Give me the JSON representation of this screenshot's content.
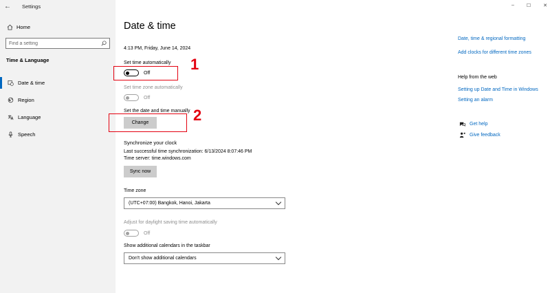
{
  "window": {
    "title": "Settings",
    "back_glyph": "←",
    "controls": [
      "–",
      "☐",
      "✕"
    ]
  },
  "sidebar": {
    "home_label": "Home",
    "search_placeholder": "Find a setting",
    "section_title": "Time & Language",
    "items": [
      {
        "label": "Date & time",
        "icon": "calendar-clock-icon",
        "active": true
      },
      {
        "label": "Region",
        "icon": "globe-icon",
        "active": false
      },
      {
        "label": "Language",
        "icon": "language-icon",
        "active": false
      },
      {
        "label": "Speech",
        "icon": "microphone-icon",
        "active": false
      }
    ]
  },
  "main": {
    "title": "Date & time",
    "current_datetime": "4:13 PM, Friday, June 14, 2024",
    "set_time_auto": {
      "label": "Set time automatically",
      "state": "Off"
    },
    "set_tz_auto": {
      "label": "Set time zone automatically",
      "state": "Off"
    },
    "set_manual": {
      "label": "Set the date and time manually",
      "button": "Change"
    },
    "sync": {
      "heading": "Synchronize your clock",
      "last_sync": "Last successful time synchronization: 6/13/2024 8:07:46 PM",
      "server": "Time server: time.windows.com",
      "button": "Sync now"
    },
    "timezone": {
      "label": "Time zone",
      "value": "(UTC+07:00) Bangkok, Hanoi, Jakarta"
    },
    "dst": {
      "label": "Adjust for daylight saving time automatically",
      "state": "Off"
    },
    "calendars": {
      "label": "Show additional calendars in the taskbar",
      "value": "Don't show additional calendars"
    }
  },
  "right": {
    "links": [
      "Date, time & regional formatting",
      "Add clocks for different time zones"
    ],
    "help_heading": "Help from the web",
    "help_links": [
      "Setting up Date and Time in Windows",
      "Setting an alarm"
    ],
    "get_help": "Get help",
    "give_feedback": "Give feedback"
  },
  "annotations": {
    "one": "1",
    "two": "2",
    "color": "#e3000f"
  },
  "colors": {
    "accent": "#0067c0",
    "sidebar_bg": "#f2f2f2",
    "button_bg": "#cccccc"
  }
}
